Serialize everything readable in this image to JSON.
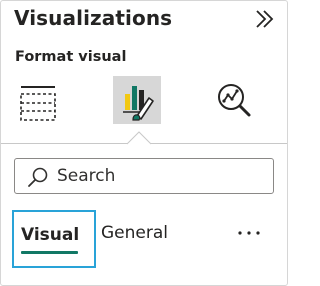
{
  "pane": {
    "title": "Visualizations",
    "subtitle": "Format visual",
    "selected_icon_tab": "format-visual"
  },
  "icons": {
    "collapse": "chevrons-right-icon",
    "build": "build-visual-icon",
    "format": "format-paintbrush-icon",
    "analytics": "analytics-magnifier-icon",
    "search": "search-icon",
    "more": "more-options-icon"
  },
  "search": {
    "placeholder": "Search"
  },
  "format_tabs": {
    "visual": "Visual",
    "general": "General",
    "selected": "Visual",
    "more": "···"
  },
  "colors": {
    "accent_green": "#117865",
    "focus_blue": "#29a3d8",
    "selected_bg": "#d7d7d7",
    "yellow": "#f2c811"
  }
}
